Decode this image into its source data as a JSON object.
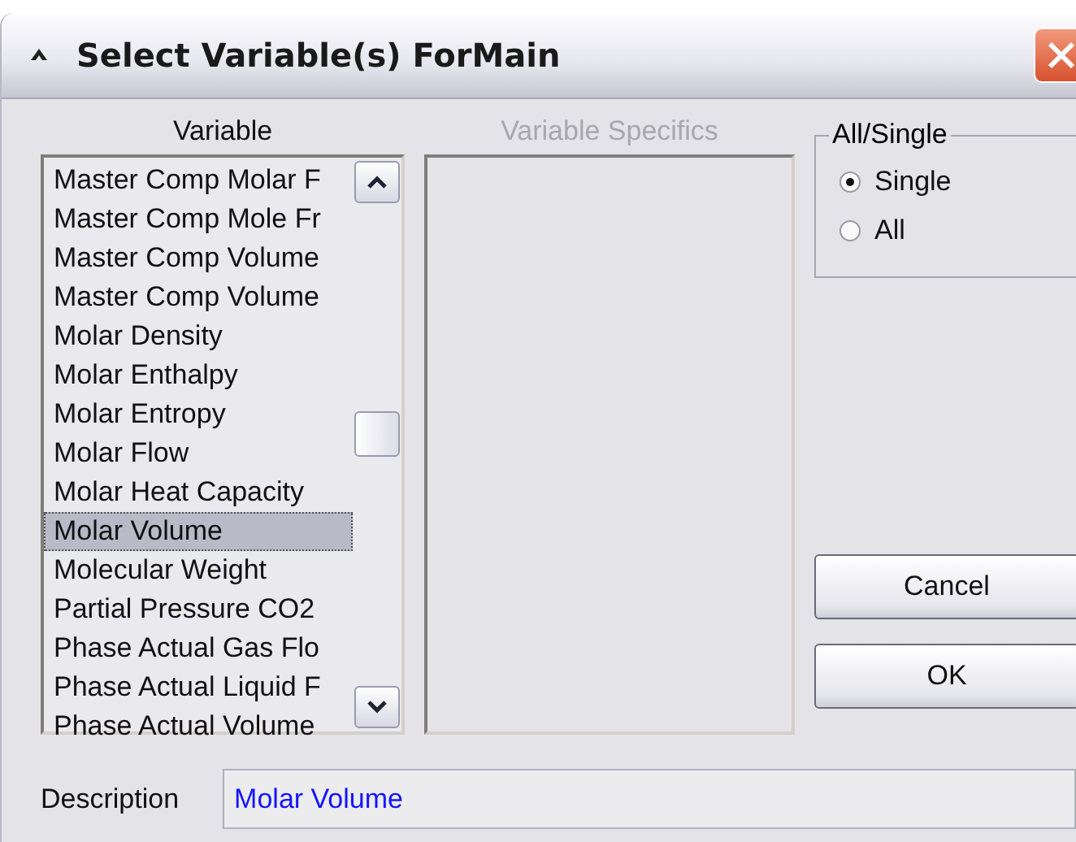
{
  "window": {
    "title": "Select Variable(s) ForMain"
  },
  "variable_list": {
    "label": "Variable",
    "items": [
      {
        "text": "Master Comp Molar F",
        "selected": false
      },
      {
        "text": "Master Comp Mole Fr",
        "selected": false
      },
      {
        "text": "Master Comp Volume",
        "selected": false
      },
      {
        "text": "Master Comp Volume",
        "selected": false
      },
      {
        "text": "Molar Density",
        "selected": false
      },
      {
        "text": "Molar Enthalpy",
        "selected": false
      },
      {
        "text": "Molar Entropy",
        "selected": false
      },
      {
        "text": "Molar Flow",
        "selected": false
      },
      {
        "text": "Molar Heat Capacity",
        "selected": false
      },
      {
        "text": "Molar Volume",
        "selected": true
      },
      {
        "text": "Molecular Weight",
        "selected": false
      },
      {
        "text": "Partial Pressure CO2",
        "selected": false
      },
      {
        "text": "Phase Actual Gas Flo",
        "selected": false
      },
      {
        "text": "Phase Actual Liquid F",
        "selected": false
      },
      {
        "text": "Phase Actual Volume",
        "selected": false
      }
    ]
  },
  "variable_specifics": {
    "label": "Variable Specifics",
    "disabled": true
  },
  "all_single": {
    "label": "All/Single",
    "options": [
      {
        "label": "Single",
        "selected": true
      },
      {
        "label": "All",
        "selected": false
      }
    ]
  },
  "buttons": [
    "Cancel",
    "OK"
  ],
  "description": {
    "label": "Description",
    "value": "Molar Volume"
  }
}
